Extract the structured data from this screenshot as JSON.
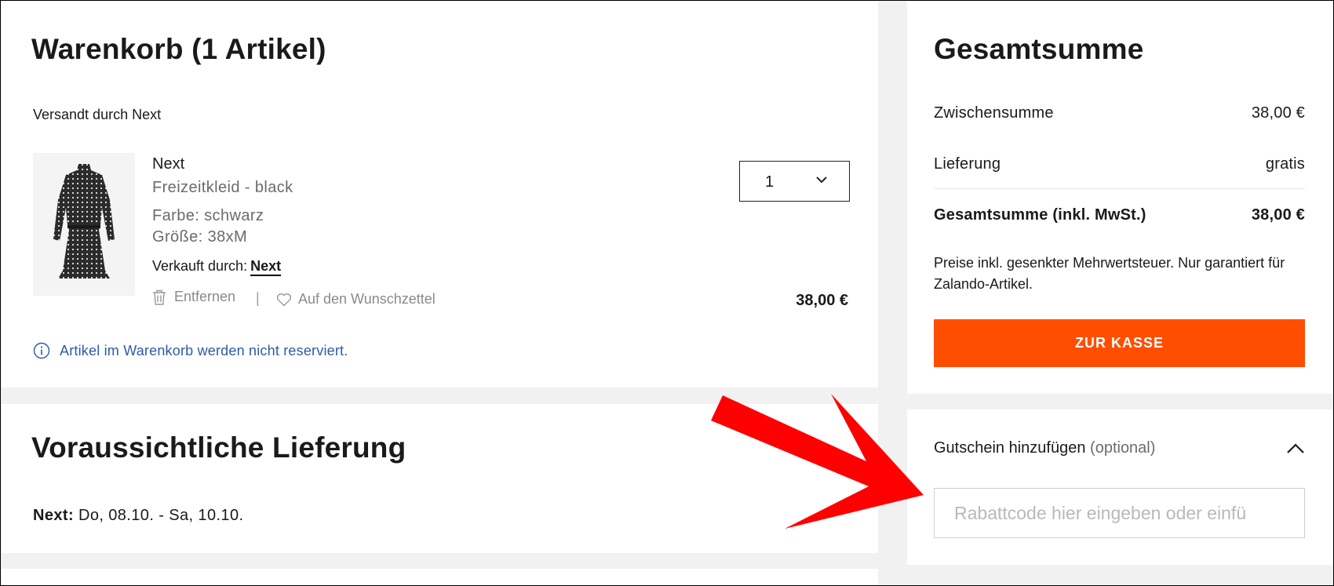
{
  "cart": {
    "title": "Warenkorb (1 Artikel)",
    "shipped_by": "Versandt durch Next",
    "item": {
      "brand": "Next",
      "name": "Freizeitkleid - black",
      "color": "Farbe: schwarz",
      "size": "Größe: 38xM",
      "sold_by_label": "Verkauft durch:",
      "sold_by_value": "Next",
      "remove_label": "Entfernen",
      "separator": "|",
      "wishlist_label": "Auf den Wunschzettel",
      "quantity": "1",
      "price": "38,00 €"
    },
    "info_note": "Artikel im Warenkorb werden nicht reserviert."
  },
  "delivery": {
    "title": "Voraussichtliche Lieferung",
    "seller": "Next:",
    "dates": "Do, 08.10. - Sa, 10.10."
  },
  "summary": {
    "title": "Gesamtsumme",
    "subtotal_label": "Zwischensumme",
    "subtotal_value": "38,00 €",
    "delivery_label": "Lieferung",
    "delivery_value": "gratis",
    "total_label": "Gesamtsumme (inkl. MwSt.)",
    "total_value": "38,00 €",
    "tax_note": "Preise inkl. gesenkter Mehrwertsteuer. Nur garantiert für Zalando-Artikel.",
    "checkout_label": "ZUR KASSE"
  },
  "voucher": {
    "label": "Gutschein hinzufügen",
    "optional": "(optional)",
    "placeholder": "Rabattcode hier eingeben oder einfü"
  },
  "colors": {
    "accent_orange": "#ff4e00",
    "info_blue": "#2e5aa8",
    "annotation_red": "#ff0000"
  }
}
